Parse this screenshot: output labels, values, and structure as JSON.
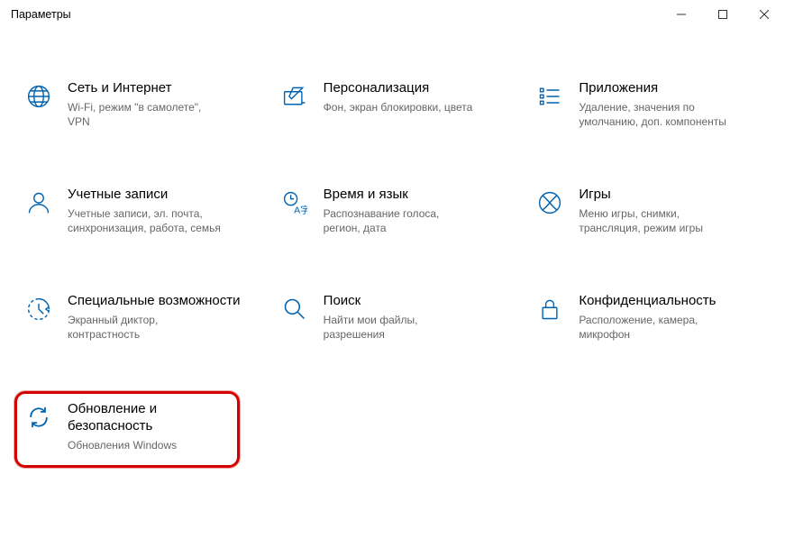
{
  "window": {
    "title": "Параметры"
  },
  "tiles": {
    "network": {
      "title": "Сеть и Интернет",
      "sub": "Wi-Fi, режим \"в самолете\", VPN"
    },
    "personalize": {
      "title": "Персонализация",
      "sub": "Фон, экран блокировки, цвета"
    },
    "apps": {
      "title": "Приложения",
      "sub": "Удаление, значения по умолчанию, доп. компоненты"
    },
    "accounts": {
      "title": "Учетные записи",
      "sub": "Учетные записи, эл. почта, синхронизация, работа, семья"
    },
    "time": {
      "title": "Время и язык",
      "sub": "Распознавание голоса, регион, дата"
    },
    "gaming": {
      "title": "Игры",
      "sub": "Меню игры, снимки, трансляция, режим игры"
    },
    "ease": {
      "title": "Специальные возможности",
      "sub": "Экранный диктор, контрастность"
    },
    "search": {
      "title": "Поиск",
      "sub": "Найти мои файлы, разрешения"
    },
    "privacy": {
      "title": "Конфиденциальность",
      "sub": "Расположение, камера, микрофон"
    },
    "update": {
      "title": "Обновление и безопасность",
      "sub": "Обновления Windows"
    }
  }
}
